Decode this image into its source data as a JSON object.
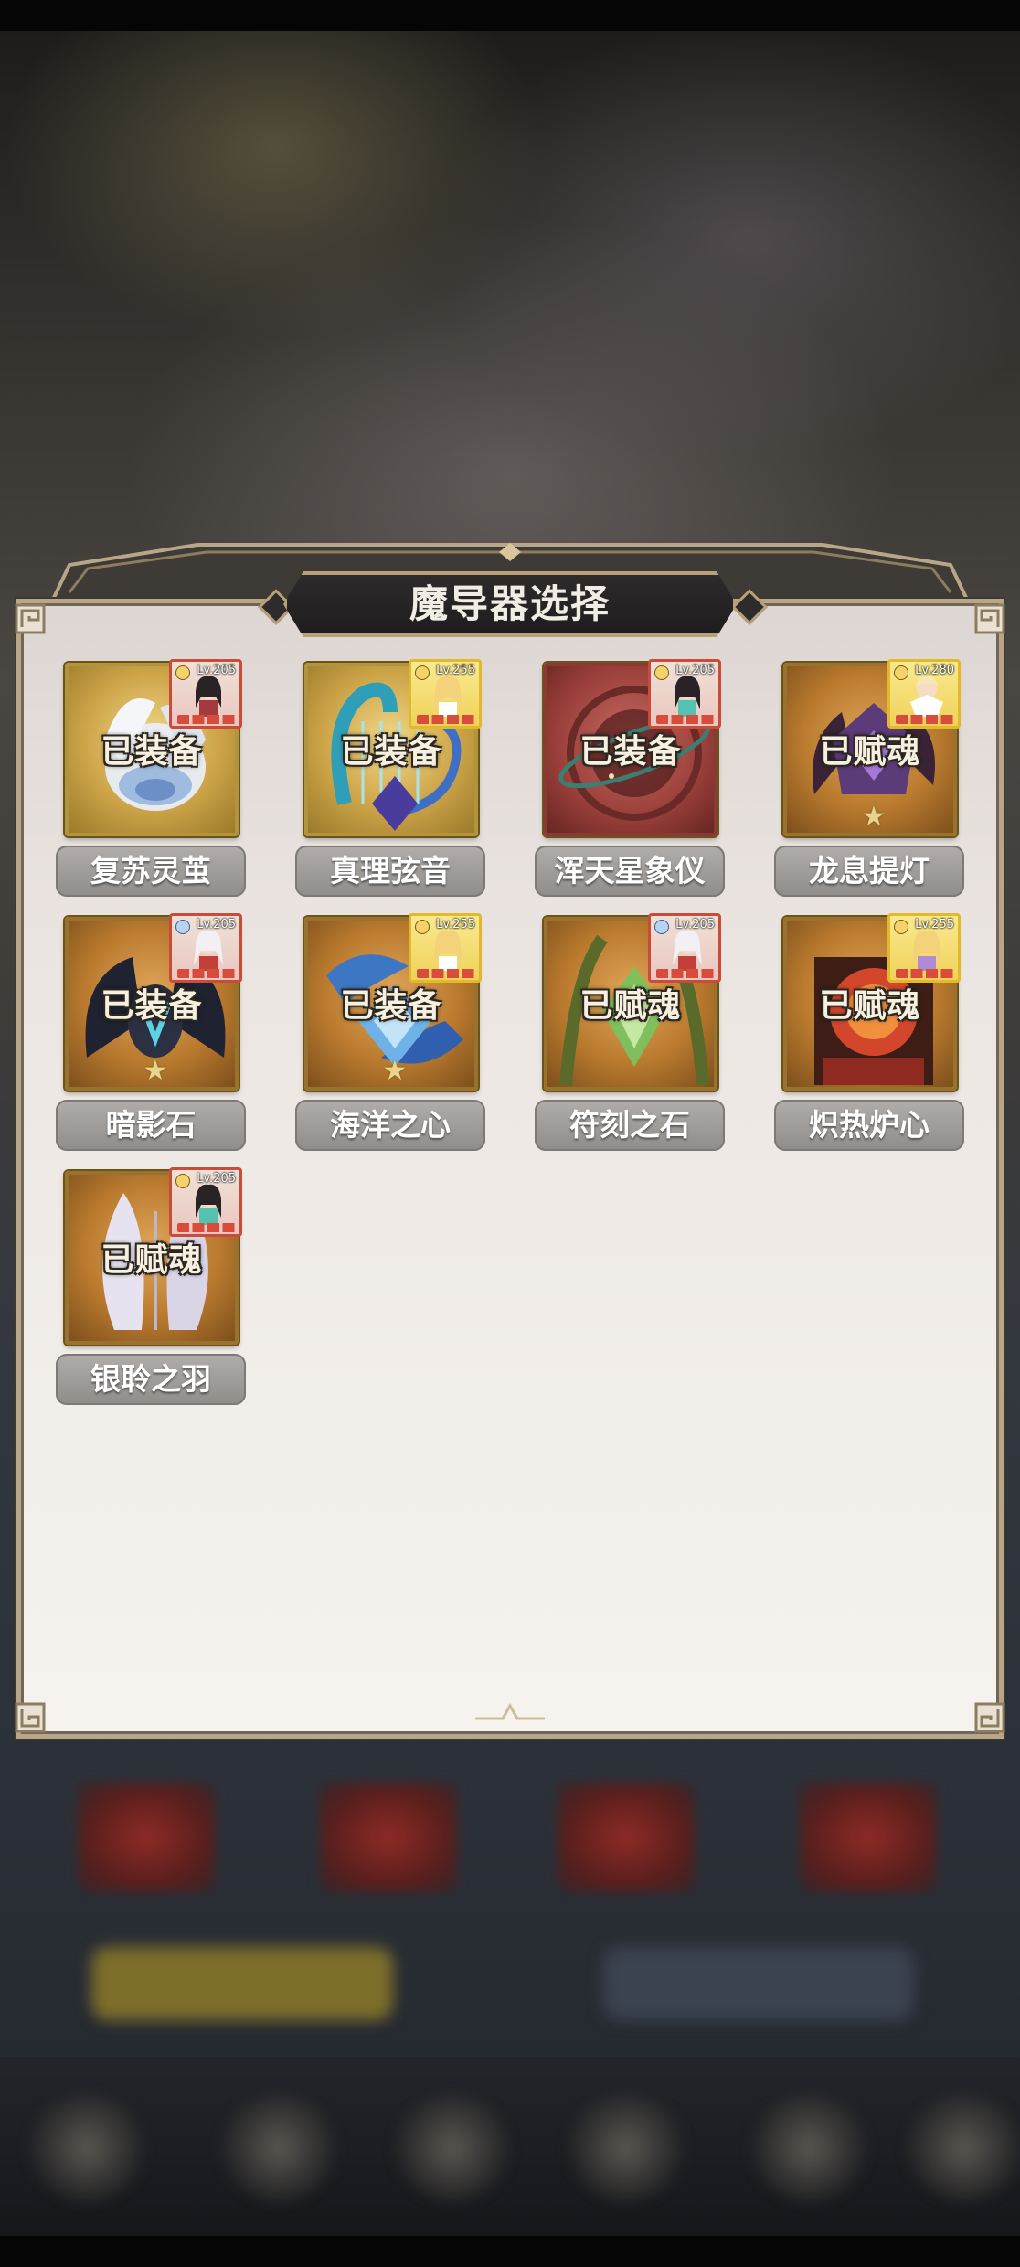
{
  "dialog": {
    "title": "魔导器选择"
  },
  "artifacts": [
    {
      "name": "复苏灵茧",
      "status": "已装备",
      "hero_level": "Lv.205",
      "frame": "gold"
    },
    {
      "name": "真理弦音",
      "status": "已装备",
      "hero_level": "Lv.255",
      "frame": "gold"
    },
    {
      "name": "浑天星象仪",
      "status": "已装备",
      "hero_level": "Lv.205",
      "frame": "red"
    },
    {
      "name": "龙息提灯",
      "status": "已赋魂",
      "hero_level": "Lv.280",
      "frame": "orange"
    },
    {
      "name": "暗影石",
      "status": "已装备",
      "hero_level": "Lv.205",
      "frame": "orange"
    },
    {
      "name": "海洋之心",
      "status": "已装备",
      "hero_level": "Lv.255",
      "frame": "orange"
    },
    {
      "name": "符刻之石",
      "status": "已赋魂",
      "hero_level": "Lv.205",
      "frame": "orange"
    },
    {
      "name": "炽热炉心",
      "status": "已赋魂",
      "hero_level": "Lv.255",
      "frame": "orange"
    },
    {
      "name": "银聆之羽",
      "status": "已赋魂",
      "hero_level": "Lv.205",
      "frame": "orange"
    }
  ],
  "colors": {
    "panel_border": "#b9a688",
    "title_bg": "#2e2b2c",
    "name_tag": "#9c9996",
    "avatar_red": "#c94b3a",
    "avatar_yellow": "#e2b92a"
  },
  "icons": {
    "artifact_star": "star-icon",
    "hero_rank": "crown-icon"
  }
}
